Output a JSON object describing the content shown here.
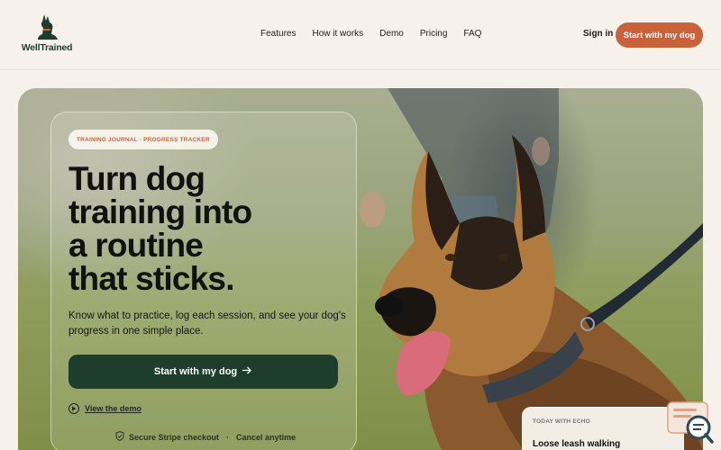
{
  "brand": {
    "name": "WellTrained"
  },
  "nav": {
    "items": [
      {
        "label": "Features"
      },
      {
        "label": "How it works"
      },
      {
        "label": "Demo"
      },
      {
        "label": "Pricing"
      },
      {
        "label": "FAQ"
      }
    ],
    "signin_label": "Sign in",
    "cta_label": "Start with my dog"
  },
  "hero": {
    "pill": "TRAINING JOURNAL · PROGRESS TRACKER",
    "title_lines": [
      "Turn dog",
      "training into",
      "a routine",
      "that sticks."
    ],
    "subtitle": "Know what to practice, log each session, and see your dog's progress in one simple place.",
    "cta_label": "Start with my dog",
    "demo_label": "View the demo",
    "trust_primary": "Secure Stripe checkout",
    "trust_secondary": "Cancel anytime"
  },
  "today_card": {
    "label": "TODAY WITH ECHO",
    "task": "Loose leash walking"
  },
  "colors": {
    "accent": "#c8623b",
    "primary_dark": "#1f3d2d",
    "background": "#f6f1ea"
  },
  "icons": {
    "logo": "dog-silhouette-icon",
    "arrow": "arrow-right-icon",
    "play": "play-circle-icon",
    "shield": "shield-check-icon",
    "chat": "chat-search-icon"
  }
}
